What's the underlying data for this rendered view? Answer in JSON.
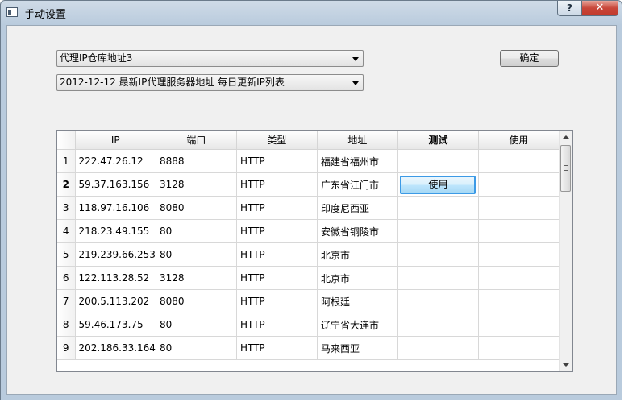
{
  "window": {
    "title": "手动设置",
    "help_label": "?",
    "close_label": "✕"
  },
  "source_select": {
    "value": "代理IP仓库地址3"
  },
  "list_select": {
    "value": "2012-12-12 最新IP代理服务器地址 每日更新IP列表"
  },
  "confirm_button": {
    "label": "确定"
  },
  "table": {
    "columns": [
      "IP",
      "端口",
      "类型",
      "地址",
      "测试",
      "使用"
    ],
    "test_button_label": "使用",
    "rows": [
      {
        "num": "1",
        "ip": "222.47.26.12",
        "port": "8888",
        "type": "HTTP",
        "addr": "福建省福州市"
      },
      {
        "num": "2",
        "ip": "59.37.163.156",
        "port": "3128",
        "type": "HTTP",
        "addr": "广东省江门市"
      },
      {
        "num": "3",
        "ip": "118.97.16.106",
        "port": "8080",
        "type": "HTTP",
        "addr": "印度尼西亚"
      },
      {
        "num": "4",
        "ip": "218.23.49.155",
        "port": "80",
        "type": "HTTP",
        "addr": "安徽省铜陵市"
      },
      {
        "num": "5",
        "ip": "219.239.66.253",
        "port": "80",
        "type": "HTTP",
        "addr": "北京市"
      },
      {
        "num": "6",
        "ip": "122.113.28.52",
        "port": "3128",
        "type": "HTTP",
        "addr": "北京市"
      },
      {
        "num": "7",
        "ip": "200.5.113.202",
        "port": "8080",
        "type": "HTTP",
        "addr": "阿根廷"
      },
      {
        "num": "8",
        "ip": "59.46.173.75",
        "port": "80",
        "type": "HTTP",
        "addr": "辽宁省大连市"
      },
      {
        "num": "9",
        "ip": "202.186.33.164",
        "port": "80",
        "type": "HTTP",
        "addr": "马来西亚"
      }
    ]
  }
}
